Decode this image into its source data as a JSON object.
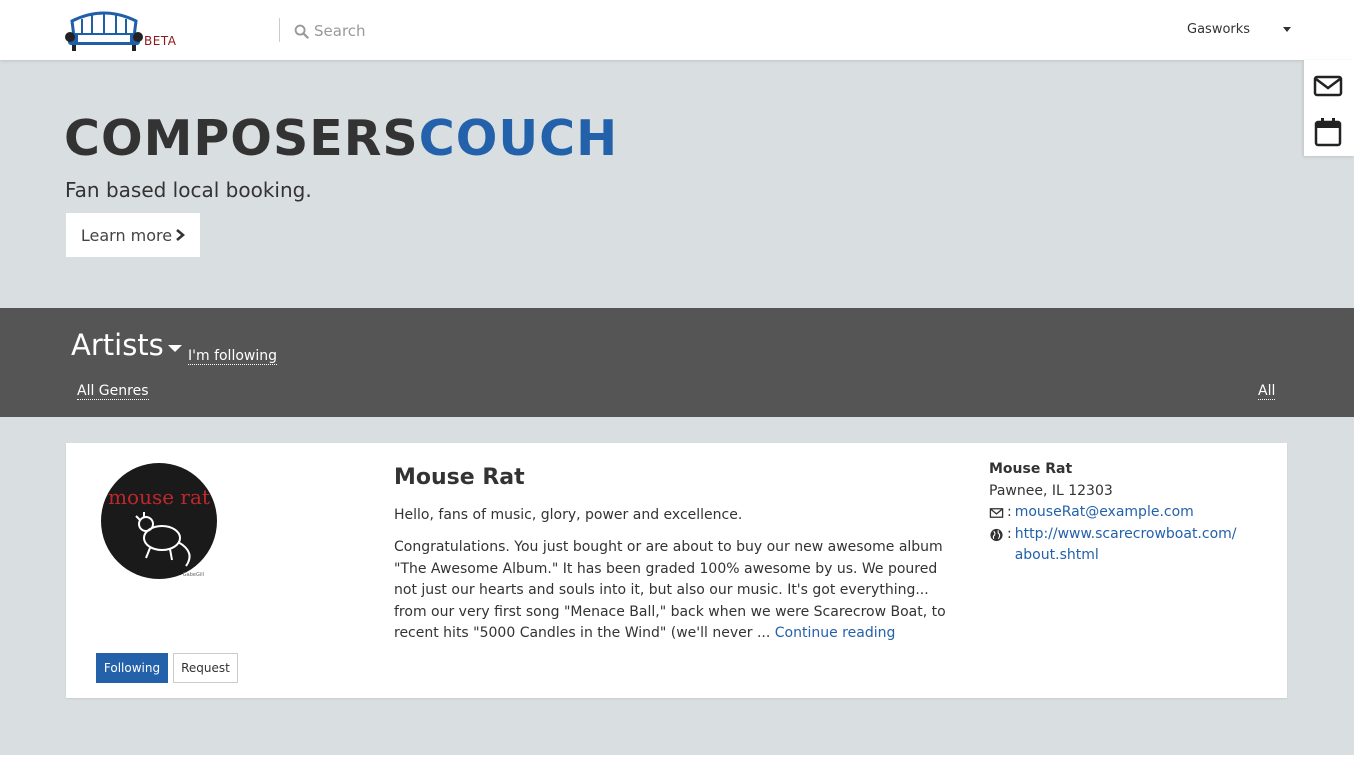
{
  "header": {
    "beta_label": "BETA",
    "search_placeholder": "Search",
    "user_menu_label": "Gasworks"
  },
  "dock": {
    "messages_icon": "envelope-icon",
    "calendar_icon": "calendar-icon"
  },
  "hero": {
    "title_part1": "COMPOSERS",
    "title_part2": "COUCH",
    "tagline": "Fan based local booking.",
    "learn_more_label": "Learn more"
  },
  "filters": {
    "section_title": "Artists",
    "following_link": "I'm following",
    "genres_link": "All Genres",
    "all_link": "All"
  },
  "artist": {
    "name": "Mouse Rat",
    "intro": "Hello, fans of music, glory, power and excellence.",
    "bio": "Congratulations. You just bought or are about to buy our new awesome album \"The Awesome Album.\" It has been graded 100% awesome by us. We poured not just our hearts and souls into it, but also our music. It's got everything... from our very first song \"Menace Ball,\" back when we were Scarecrow Boat, to recent hits \"5000 Candles in the Wind\" (we'll never ...",
    "continue_label": "Continue reading",
    "avatar_text": "mouse rat",
    "avatar_signature": "GabeGill",
    "following_label": "Following",
    "request_label": "Request",
    "contact": {
      "name": "Mouse Rat",
      "location": "Pawnee, IL 12303",
      "email_sep": ":",
      "email": "mouseRat@example.com",
      "website_sep": ":",
      "website": "http://www.scarecrowboat.com/about.shtml"
    }
  },
  "colors": {
    "accent": "#2361ab",
    "beta": "#8b1a1a",
    "filter_bar": "#555555",
    "page_bg": "#d9dee1"
  }
}
